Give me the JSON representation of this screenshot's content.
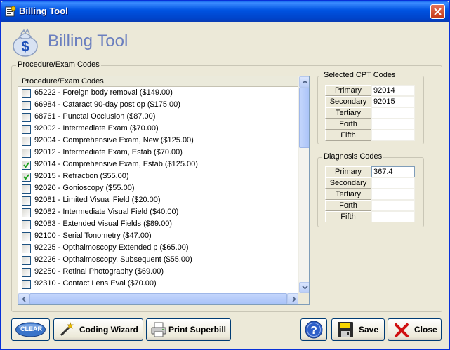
{
  "window": {
    "title": "Billing Tool"
  },
  "header": {
    "title": "Billing Tool"
  },
  "procedure_group": {
    "legend": "Procedure/Exam Codes",
    "column_header": "Procedure/Exam Codes",
    "items": [
      {
        "label": "65222 - Foreign body removal  ($149.00)",
        "checked": false
      },
      {
        "label": "66984 - Cataract 90-day post op ($175.00)",
        "checked": false
      },
      {
        "label": "68761 - Punctal Occlusion ($87.00)",
        "checked": false
      },
      {
        "label": "92002 - Intermediate Exam ($70.00)",
        "checked": false
      },
      {
        "label": "92004 - Comprehensive Exam, New ($125.00)",
        "checked": false
      },
      {
        "label": "92012 - Intermediate Exam, Estab ($70.00)",
        "checked": false
      },
      {
        "label": "92014 - Comprehensive Exam, Estab ($125.00)",
        "checked": true
      },
      {
        "label": "92015 - Refraction ($55.00)",
        "checked": true
      },
      {
        "label": "92020 - Gonioscopy ($55.00)",
        "checked": false
      },
      {
        "label": "92081 - Limited Visual Field ($20.00)",
        "checked": false
      },
      {
        "label": "92082 - Intermediate Visual Field ($40.00)",
        "checked": false
      },
      {
        "label": "92083 - Extended Visual Fields ($89.00)",
        "checked": false
      },
      {
        "label": "92100 - Serial Tonometry ($47.00)",
        "checked": false
      },
      {
        "label": "92225 - Opthalmoscopy Extended  p ($65.00)",
        "checked": false
      },
      {
        "label": "92226 - Opthalmoscopy, Subsequent ($55.00)",
        "checked": false
      },
      {
        "label": "92250 - Retinal Photography ($69.00)",
        "checked": false
      },
      {
        "label": "92310 - Contact Lens Eval ($70.00)",
        "checked": false
      }
    ]
  },
  "cpt_group": {
    "legend": "Selected CPT Codes",
    "rows": [
      {
        "label": "Primary",
        "value": "92014"
      },
      {
        "label": "Secondary",
        "value": "92015"
      },
      {
        "label": "Tertiary",
        "value": ""
      },
      {
        "label": "Forth",
        "value": ""
      },
      {
        "label": "Fifth",
        "value": ""
      }
    ]
  },
  "diagnosis_group": {
    "legend": "Diagnosis Codes",
    "rows": [
      {
        "label": "Primary",
        "value": "367.4"
      },
      {
        "label": "Secondary",
        "value": ""
      },
      {
        "label": "Tertiary",
        "value": ""
      },
      {
        "label": "Forth",
        "value": ""
      },
      {
        "label": "Fifth",
        "value": ""
      }
    ]
  },
  "buttons": {
    "clear": "CLEAR",
    "coding_wizard": "Coding Wizard",
    "print_superbill": "Print Superbill",
    "save": "Save",
    "close": "Close"
  },
  "colors": {
    "title_bar": "#0054e3",
    "header_text": "#6b7fbf",
    "accent_green": "#2e8b2e",
    "close_red": "#d01010"
  }
}
